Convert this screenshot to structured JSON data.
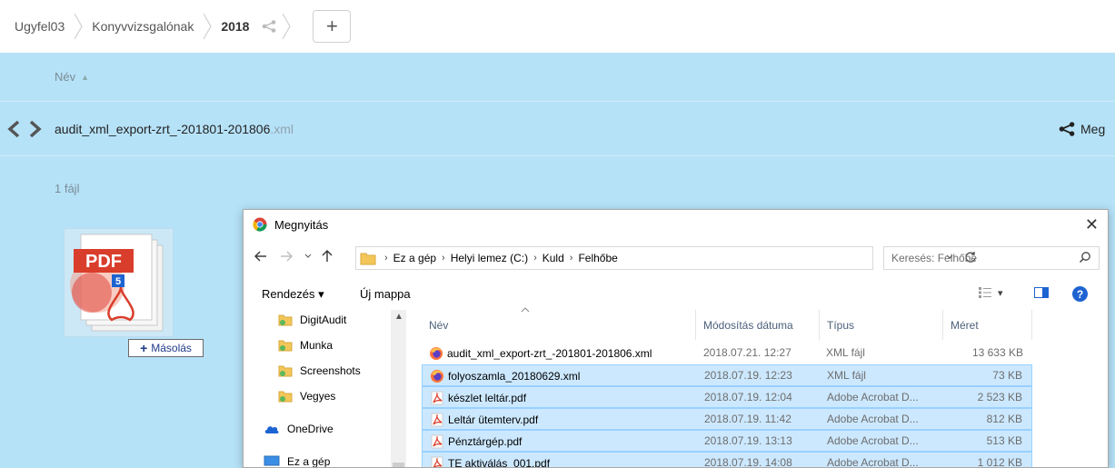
{
  "breadcrumb": {
    "items": [
      "Ugyfel03",
      "Konyvvizsgalónak",
      "2018"
    ],
    "add_label": "+"
  },
  "list_header": {
    "name_label": "Név",
    "sort_arrow": "▲"
  },
  "file": {
    "name": "audit_xml_export-zrt_-201801-201806",
    "ext": ".xml",
    "share_label": "Meg"
  },
  "summary": "1 fájl",
  "drag": {
    "pdf_label": "PDF",
    "count": "5",
    "copy_label": "Másolás",
    "copy_plus": "+"
  },
  "dialog": {
    "title": "Megnyitás",
    "close": "✕",
    "path": [
      "Ez a gép",
      "Helyi lemez (C:)",
      "Kuld",
      "Felhőbe"
    ],
    "search_placeholder": "Keresés: Felhőbe",
    "organize": "Rendezés ▾",
    "new_folder": "Új mappa",
    "view_caret": "▾",
    "help": "?",
    "nav": [
      {
        "label": "DigitAudit",
        "icon": "folder-user-icon"
      },
      {
        "label": "Munka",
        "icon": "folder-user-icon"
      },
      {
        "label": "Screenshots",
        "icon": "folder-user-icon"
      },
      {
        "label": "Vegyes",
        "icon": "folder-user-icon"
      },
      {
        "label": "OneDrive",
        "icon": "onedrive-icon"
      },
      {
        "label": "Ez a gép",
        "icon": "computer-icon"
      }
    ],
    "columns": {
      "name": "Név",
      "date": "Módosítás dátuma",
      "type": "Típus",
      "size": "Méret"
    },
    "files": [
      {
        "name": "audit_xml_export-zrt_-201801-201806.xml",
        "date": "2018.07.21. 12:27",
        "type": "XML fájl",
        "size": "13 633 KB",
        "icon": "firefox-icon",
        "selected": false
      },
      {
        "name": "folyoszamla_20180629.xml",
        "date": "2018.07.19. 12:23",
        "type": "XML fájl",
        "size": "73 KB",
        "icon": "firefox-icon",
        "selected": true
      },
      {
        "name": "készlet leltár.pdf",
        "date": "2018.07.19. 12:04",
        "type": "Adobe Acrobat D...",
        "size": "2 523 KB",
        "icon": "pdf-icon",
        "selected": true
      },
      {
        "name": "Leltár ütemterv.pdf",
        "date": "2018.07.19. 11:42",
        "type": "Adobe Acrobat D...",
        "size": "812 KB",
        "icon": "pdf-icon",
        "selected": true
      },
      {
        "name": "Pénztárgép.pdf",
        "date": "2018.07.19. 13:13",
        "type": "Adobe Acrobat D...",
        "size": "513 KB",
        "icon": "pdf-icon",
        "selected": true
      },
      {
        "name": "TE aktiválás_001.pdf",
        "date": "2018.07.19. 14:08",
        "type": "Adobe Acrobat D...",
        "size": "1 012 KB",
        "icon": "pdf-icon",
        "selected": true
      }
    ]
  },
  "colors": {
    "blue_bg": "#b6e2f8",
    "selection": "#cce8ff",
    "pdf_red": "#d93d2b"
  }
}
